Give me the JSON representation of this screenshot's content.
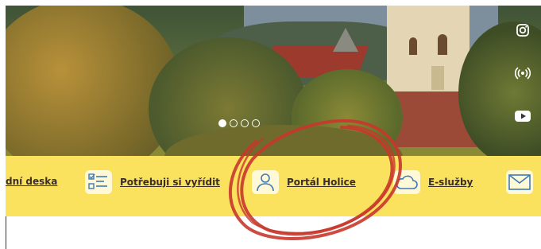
{
  "hero": {
    "carousel": {
      "slide_count": 4,
      "active_index": 0
    }
  },
  "social": [
    {
      "icon": "instagram-icon"
    },
    {
      "icon": "podcast-icon"
    },
    {
      "icon": "youtube-icon"
    }
  ],
  "nav": {
    "items": [
      {
        "label": "dní deska",
        "icon": ""
      },
      {
        "label": "Potřebuji si vyřídit",
        "icon": "checklist-icon"
      },
      {
        "label": "Portál Holice",
        "icon": "user-icon"
      },
      {
        "label": "E-služby",
        "icon": "cloud-icon"
      },
      {
        "label": "",
        "icon": "envelope-icon"
      }
    ]
  },
  "colors": {
    "accent_bar": "#fbe25e",
    "highlight_circle": "#c8372b",
    "text": "#3a2f2a"
  }
}
